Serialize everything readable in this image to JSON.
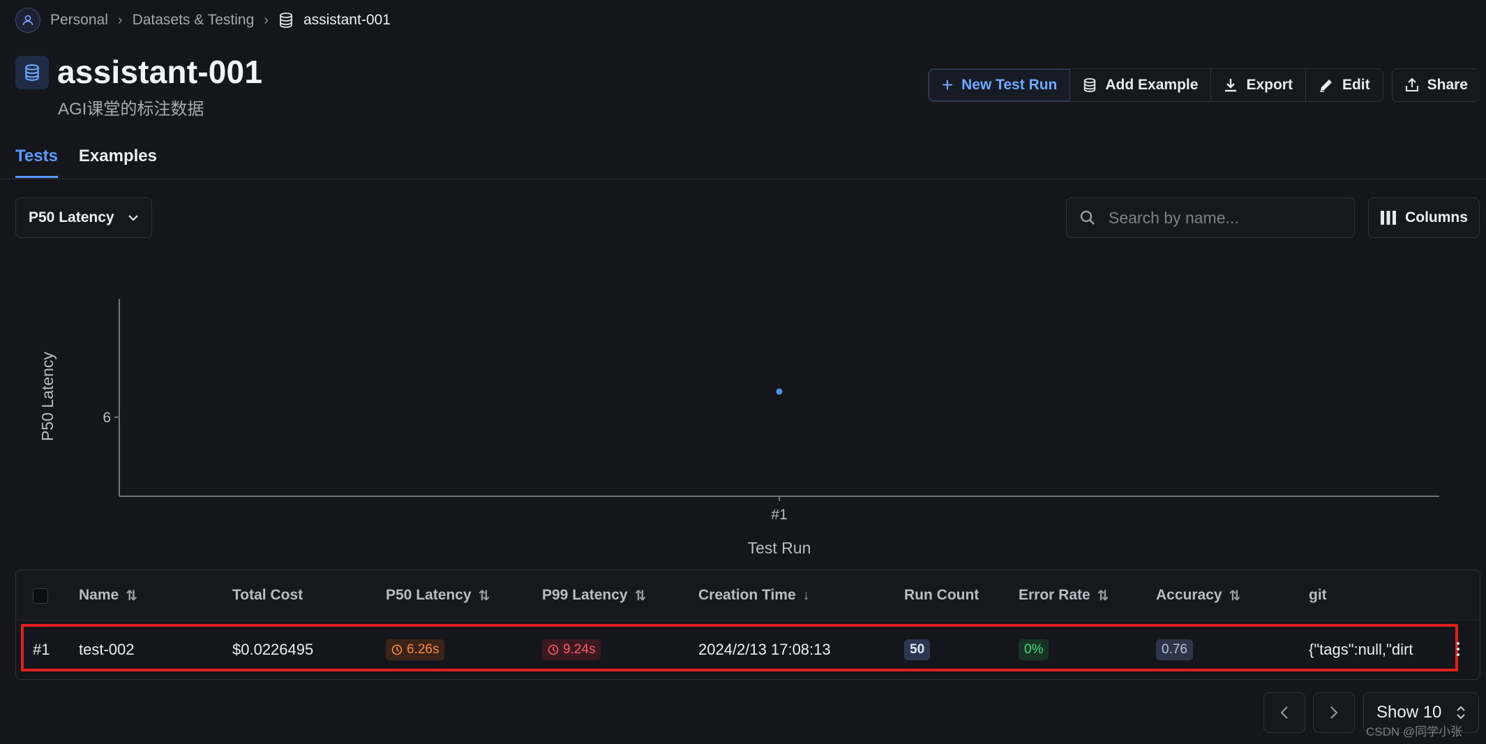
{
  "breadcrumb": {
    "items": [
      "Personal",
      "Datasets & Testing",
      "assistant-001"
    ]
  },
  "header": {
    "title": "assistant-001",
    "subtitle": "AGI课堂的标注数据"
  },
  "toolbar": {
    "new_test_run": "New Test Run",
    "add_example": "Add Example",
    "export": "Export",
    "edit": "Edit",
    "share": "Share"
  },
  "tabs": [
    {
      "label": "Tests",
      "active": true
    },
    {
      "label": "Examples",
      "active": false
    }
  ],
  "filters": {
    "metric_selected": "P50 Latency",
    "search_placeholder": "Search by name...",
    "columns_label": "Columns"
  },
  "chart_data": {
    "type": "scatter",
    "xlabel": "Test Run",
    "ylabel": "P50 Latency",
    "categories": [
      "#1"
    ],
    "y_ticks": [
      6
    ],
    "values": [
      6.26
    ],
    "ylim": [
      5.2,
      7.2
    ],
    "grid": false,
    "color": "#4f8fe8"
  },
  "table": {
    "headers": {
      "name": "Name",
      "total_cost": "Total Cost",
      "p50": "P50 Latency",
      "p99": "P99 Latency",
      "created": "Creation Time",
      "run_count": "Run Count",
      "error_rate": "Error Rate",
      "accuracy": "Accuracy",
      "git": "git"
    },
    "rows": [
      {
        "index": "#1",
        "name": "test-002",
        "total_cost": "$0.0226495",
        "p50": "6.26s",
        "p99": "9.24s",
        "created": "2024/2/13 17:08:13",
        "run_count": "50",
        "error_rate": "0%",
        "accuracy": "0.76",
        "git": "{\"tags\":null,\"dirt"
      }
    ]
  },
  "pagination": {
    "show_label": "Show 10"
  },
  "watermark": "CSDN @同学小张",
  "colors": {
    "accent": "#5b9bff",
    "highlight_border": "#e0201e",
    "background": "#15161b"
  }
}
